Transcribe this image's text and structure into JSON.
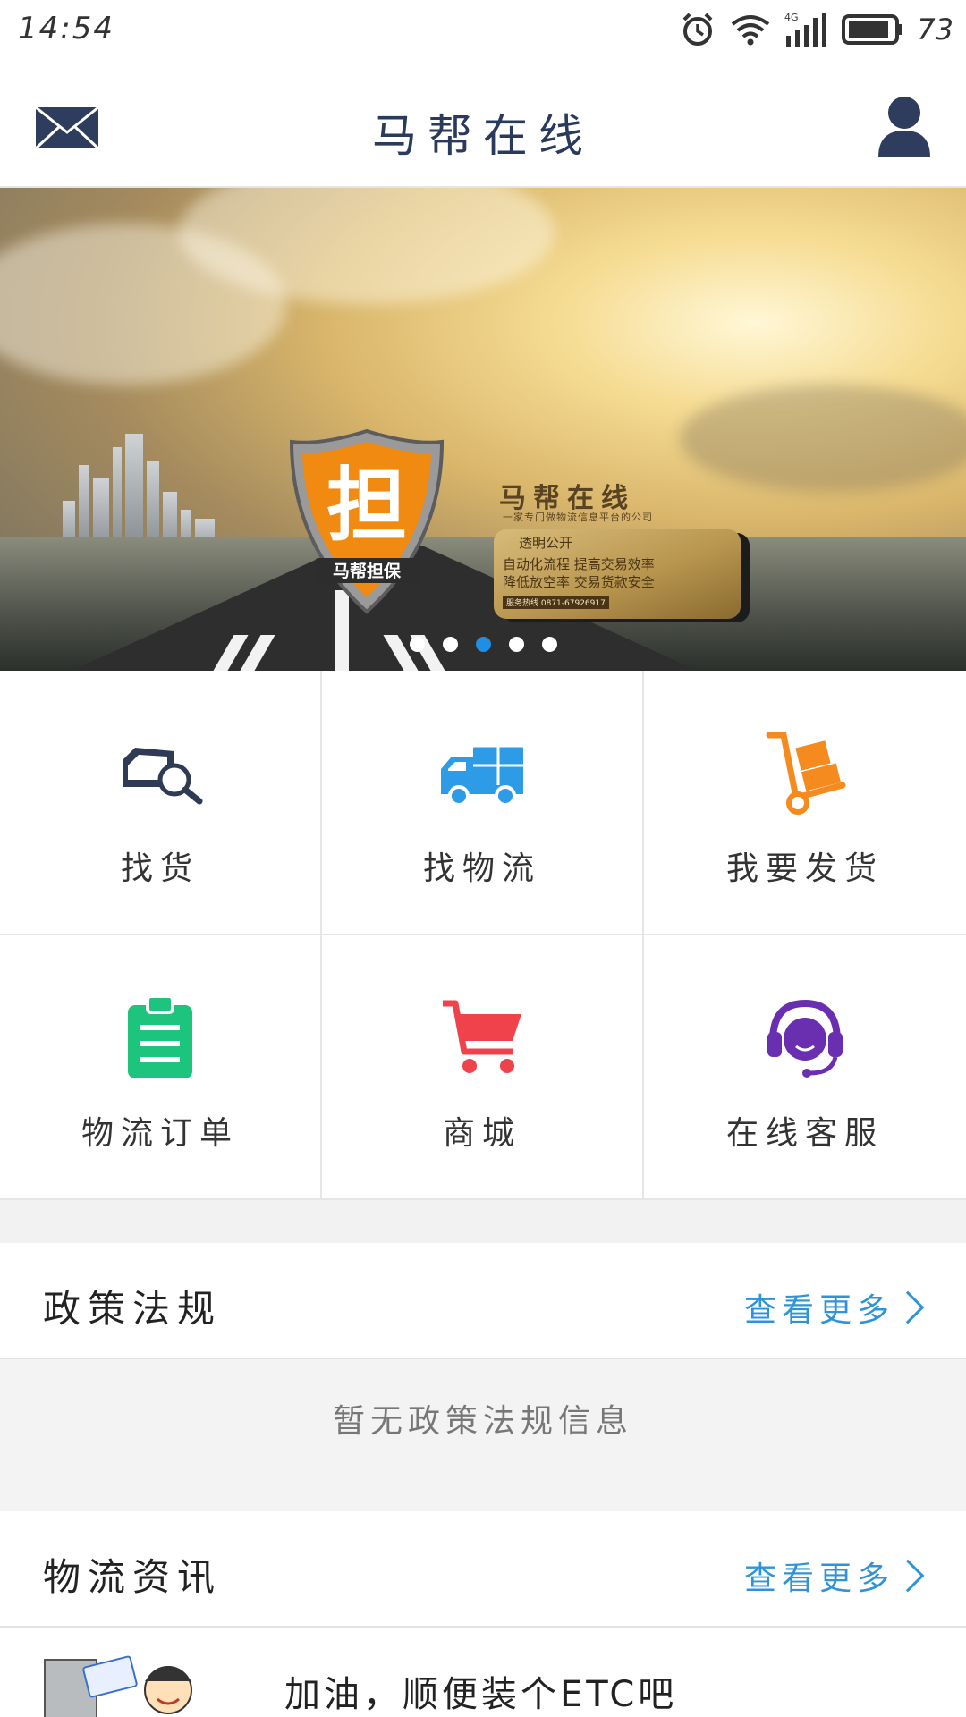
{
  "status_bar": {
    "time": "14:54",
    "network": "4G",
    "battery": "73"
  },
  "header": {
    "title": "马帮在线",
    "mail_icon": "mail-icon",
    "user_icon": "user-icon"
  },
  "banner": {
    "shield_char": "担",
    "shield_caption": "马帮担保",
    "brand": "马帮在线",
    "subtitle": "一家专门做物流信息平台的公司",
    "card_title": "透明公开",
    "card_line1": "自动化流程  提高交易效率",
    "card_line2": "降低放空率  交易货款安全",
    "card_hotline": "服务热线   0871-67926917",
    "dots": {
      "count": 5,
      "active_index": 2
    }
  },
  "grid": [
    {
      "label": "找货",
      "icon": "find-cargo-icon",
      "color": "#2f3b55"
    },
    {
      "label": "找物流",
      "icon": "truck-icon",
      "color": "#2d9be6"
    },
    {
      "label": "我要发货",
      "icon": "hand-truck-icon",
      "color": "#f58a1f"
    },
    {
      "label": "物流订单",
      "icon": "clipboard-icon",
      "color": "#1cc47e"
    },
    {
      "label": "商城",
      "icon": "shopping-cart-icon",
      "color": "#f0424a"
    },
    {
      "label": "在线客服",
      "icon": "headset-icon",
      "color": "#6a2fb0"
    }
  ],
  "policy": {
    "title": "政策法规",
    "more": "查看更多",
    "empty": "暂无政策法规信息"
  },
  "news": {
    "title": "物流资讯",
    "more": "查看更多",
    "items": [
      {
        "title": "加油，顺便装个ETC吧"
      }
    ]
  },
  "colors": {
    "link": "#2e93d8",
    "header_title": "#2a3a5c",
    "active_dot": "#1f8fe6"
  }
}
